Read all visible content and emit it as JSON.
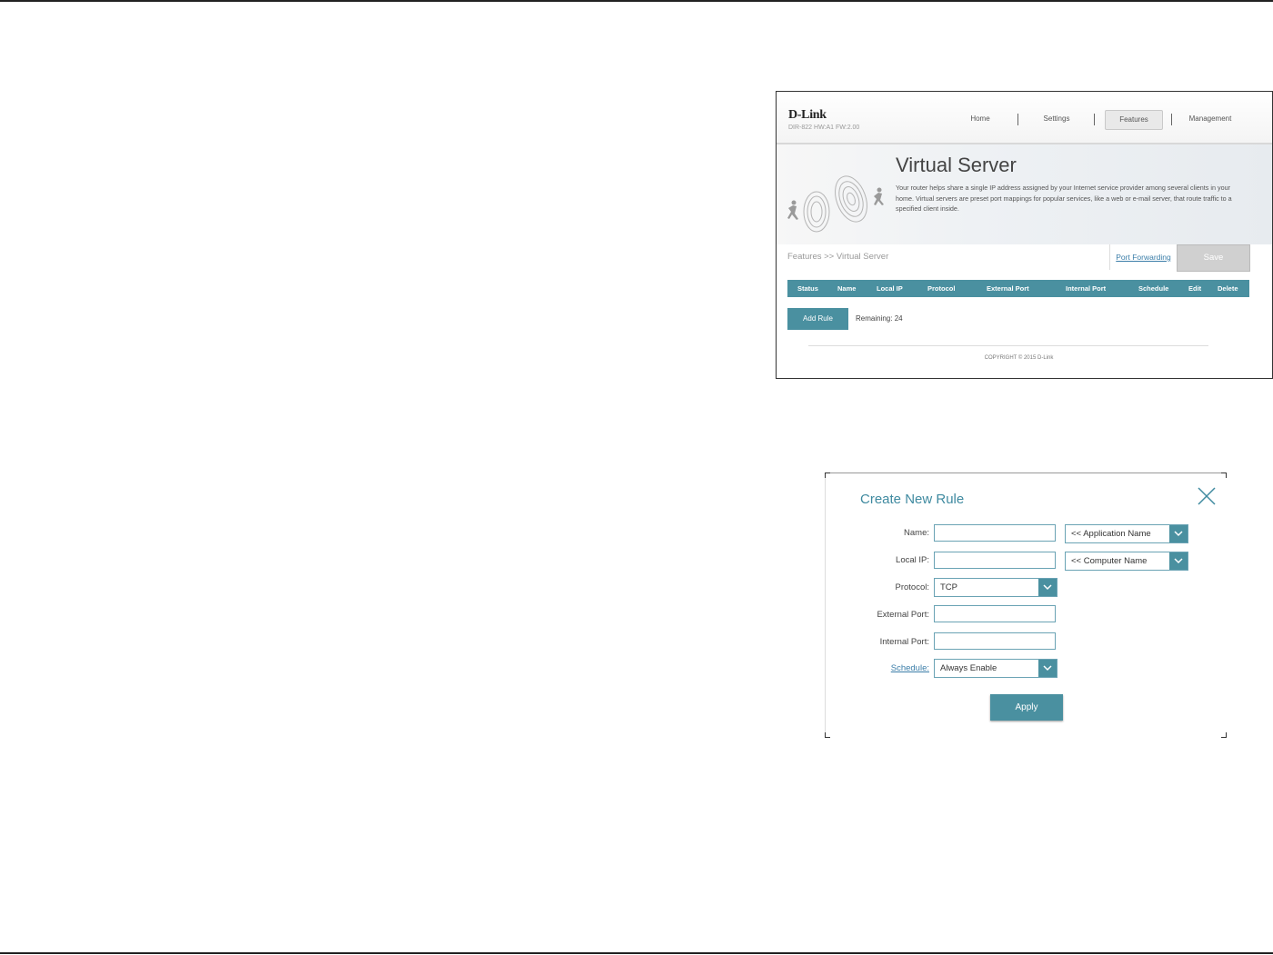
{
  "router": {
    "logo": "D-Link",
    "model": "DIR-822 HW:A1 FW:2.00",
    "nav": [
      "Home",
      "Settings",
      "Features",
      "Management"
    ],
    "active_nav": "Features",
    "banner_title": "Virtual Server",
    "banner_description": "Your router helps share a single IP address assigned by your Internet service provider among several clients in your home. Virtual servers are preset port mappings for popular services, like a web or e-mail server, that route traffic to a specified client inside.",
    "breadcrumb": "Features >> Virtual Server",
    "port_forwarding_link": "Port Forwarding",
    "save_label": "Save",
    "table_headers": [
      "Status",
      "Name",
      "Local IP",
      "Protocol",
      "External Port",
      "Internal Port",
      "Schedule",
      "Edit",
      "Delete"
    ],
    "add_rule_label": "Add Rule",
    "remaining": "Remaining: 24",
    "copyright": "COPYRIGHT © 2015 D-Link"
  },
  "dialog": {
    "title": "Create New Rule",
    "labels": {
      "name": "Name:",
      "local_ip": "Local IP:",
      "protocol": "Protocol:",
      "external_port": "External Port:",
      "internal_port": "Internal Port:",
      "schedule": "Schedule:"
    },
    "values": {
      "name": "",
      "local_ip": "",
      "external_port": "",
      "internal_port": ""
    },
    "application_select": "<< Application Name",
    "computer_select": "<< Computer Name",
    "protocol_select": "TCP",
    "schedule_select": "Always Enable",
    "apply_label": "Apply"
  },
  "colors": {
    "accent": "#4a90a0",
    "title_teal": "#3f8aa0",
    "link": "#3a7da8",
    "save_disabled": "#d0d0d0"
  }
}
